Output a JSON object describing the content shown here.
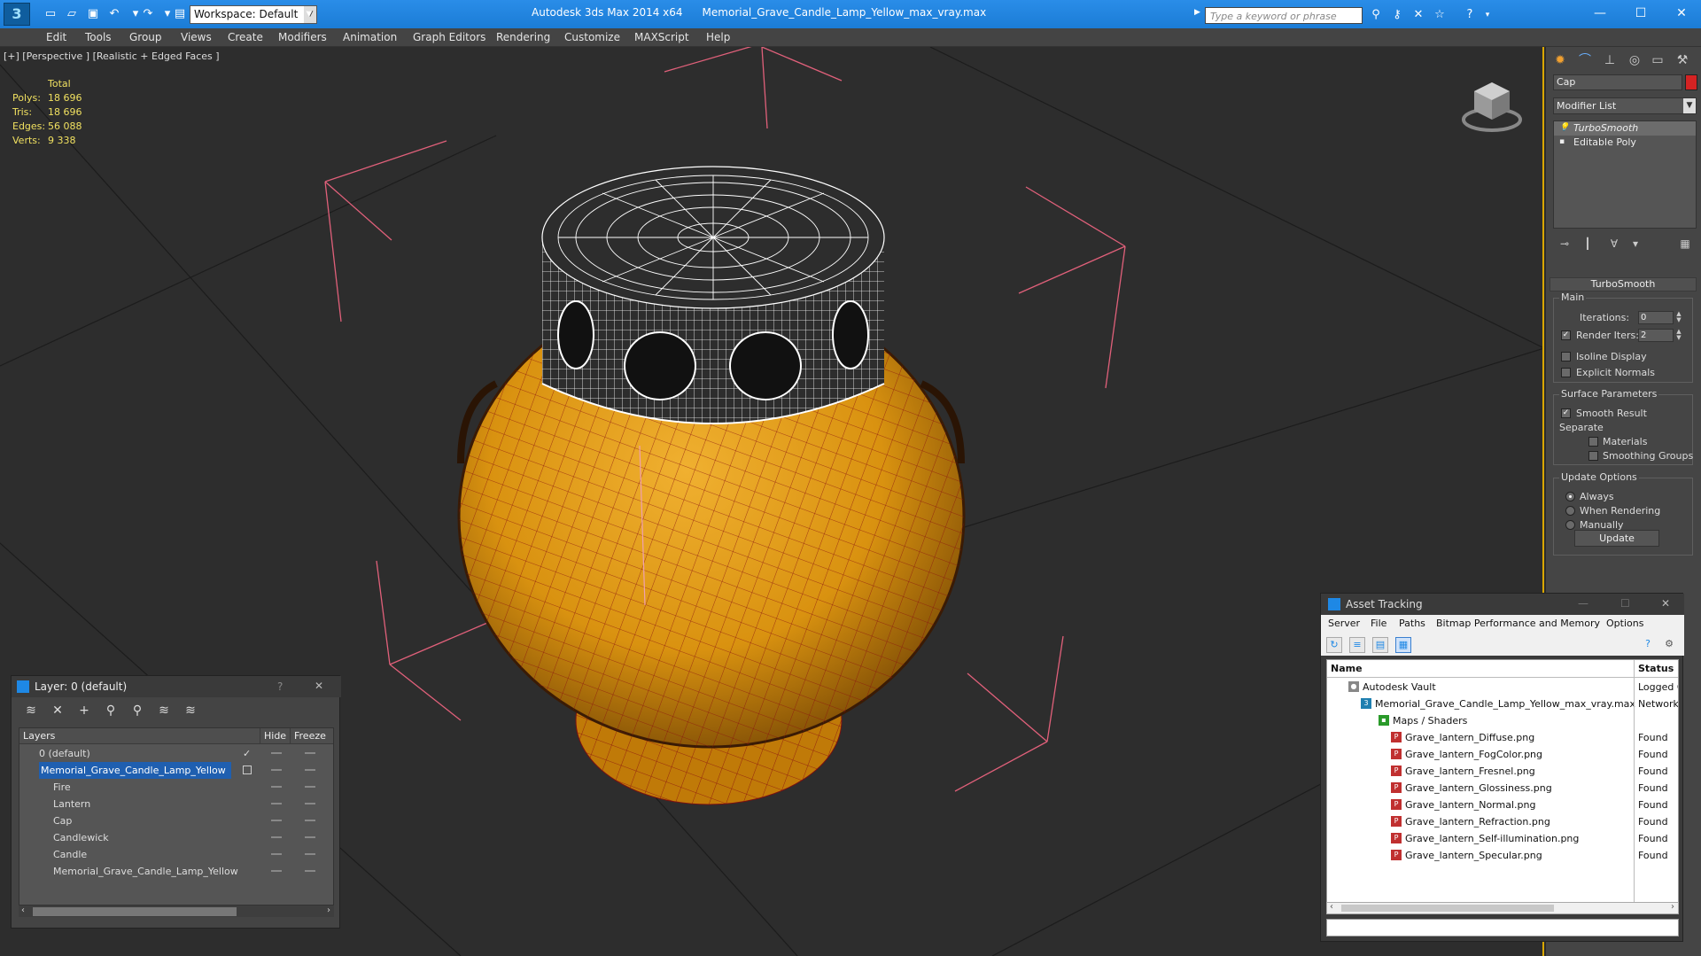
{
  "titlebar": {
    "workspace": "Workspace: Default",
    "app_name": "Autodesk 3ds Max  2014 x64",
    "file_name": "Memorial_Grave_Candle_Lamp_Yellow_max_vray.max",
    "search_placeholder": "Type a keyword or phrase",
    "minimize": "—",
    "maximize": "☐",
    "close": "✕"
  },
  "menu": [
    "Edit",
    "Tools",
    "Group",
    "Views",
    "Create",
    "Modifiers",
    "Animation",
    "Graph Editors",
    "Rendering",
    "Customize",
    "MAXScript",
    "Help"
  ],
  "viewport": {
    "label": "[+] [Perspective ] [Realistic + Edged Faces ]",
    "stats": {
      "total_label": "Total",
      "rows": [
        {
          "k": "Polys:",
          "v": "18 696"
        },
        {
          "k": "Tris:",
          "v": "18 696"
        },
        {
          "k": "Edges:",
          "v": "56 088"
        },
        {
          "k": "Verts:",
          "v": "9 338"
        }
      ]
    }
  },
  "command_panel": {
    "object_name": "Cap",
    "object_color": "#d42323",
    "modifier_list": "Modifier List",
    "stack": [
      {
        "label": "TurboSmooth",
        "selected": true
      },
      {
        "label": "Editable Poly",
        "selected": false
      }
    ],
    "rollout_title": "TurboSmooth",
    "main_group": "Main",
    "iterations_label": "Iterations:",
    "iterations_value": "0",
    "render_iters_label": "Render Iters:",
    "render_iters_value": "2",
    "isoline_label": "Isoline Display",
    "explicit_label": "Explicit Normals",
    "surface_group": "Surface Parameters",
    "smooth_result_label": "Smooth Result",
    "separate_label": "Separate",
    "materials_label": "Materials",
    "smoothing_groups_label": "Smoothing Groups",
    "update_group": "Update Options",
    "always_label": "Always",
    "when_rendering_label": "When Rendering",
    "manually_label": "Manually",
    "update_button": "Update"
  },
  "layer_window": {
    "title": "Layer: 0 (default)",
    "help": "?",
    "close": "✕",
    "col_layers": "Layers",
    "col_hide": "Hide",
    "col_freeze": "Freeze",
    "rows": [
      {
        "name": "0 (default)",
        "indent": 0
      },
      {
        "name": "Memorial_Grave_Candle_Lamp_Yellow",
        "indent": 0
      },
      {
        "name": "Fire",
        "indent": 1
      },
      {
        "name": "Lantern",
        "indent": 1
      },
      {
        "name": "Cap",
        "indent": 1
      },
      {
        "name": "Candlewick",
        "indent": 1
      },
      {
        "name": "Candle",
        "indent": 1
      },
      {
        "name": "Memorial_Grave_Candle_Lamp_Yellow",
        "indent": 1
      }
    ]
  },
  "asset_window": {
    "title": "Asset Tracking",
    "menu": [
      "Server",
      "File",
      "Paths",
      "Bitmap Performance and Memory",
      "Options"
    ],
    "col_name": "Name",
    "col_status": "Status",
    "rows": [
      {
        "name": "Autodesk Vault",
        "status": "Logged C",
        "indent": 1
      },
      {
        "name": "Memorial_Grave_Candle_Lamp_Yellow_max_vray.max",
        "status": "Network P",
        "indent": 2
      },
      {
        "name": "Maps / Shaders",
        "status": "",
        "indent": 3
      },
      {
        "name": "Grave_lantern_Diffuse.png",
        "status": "Found",
        "indent": 4
      },
      {
        "name": "Grave_lantern_FogColor.png",
        "status": "Found",
        "indent": 4
      },
      {
        "name": "Grave_lantern_Fresnel.png",
        "status": "Found",
        "indent": 4
      },
      {
        "name": "Grave_lantern_Glossiness.png",
        "status": "Found",
        "indent": 4
      },
      {
        "name": "Grave_lantern_Normal.png",
        "status": "Found",
        "indent": 4
      },
      {
        "name": "Grave_lantern_Refraction.png",
        "status": "Found",
        "indent": 4
      },
      {
        "name": "Grave_lantern_Self-illumination.png",
        "status": "Found",
        "indent": 4
      },
      {
        "name": "Grave_lantern_Specular.png",
        "status": "Found",
        "indent": 4
      }
    ]
  }
}
